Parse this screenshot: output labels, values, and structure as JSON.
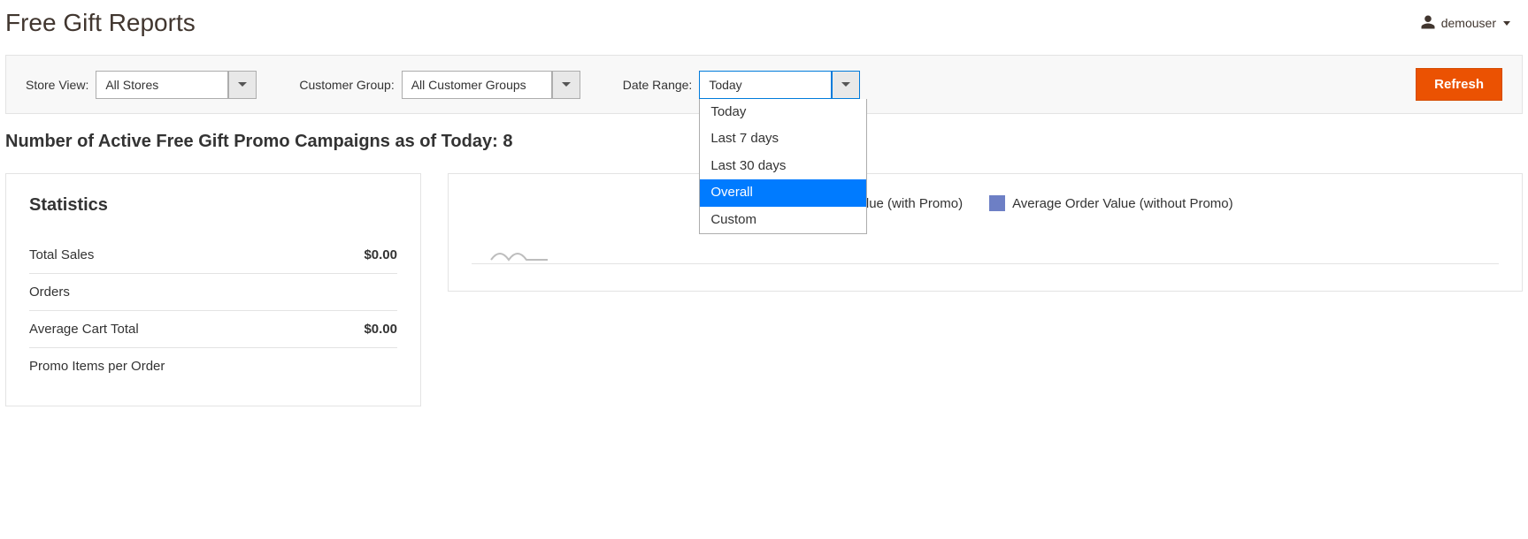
{
  "header": {
    "title": "Free Gift Reports",
    "user": "demouser"
  },
  "filters": {
    "store_view": {
      "label": "Store View:",
      "value": "All Stores"
    },
    "customer_group": {
      "label": "Customer Group:",
      "value": "All Customer Groups"
    },
    "date_range": {
      "label": "Date Range:",
      "value": "Today",
      "options": [
        "Today",
        "Last 7 days",
        "Last 30 days",
        "Overall",
        "Custom"
      ],
      "highlighted_index": 3
    },
    "refresh_label": "Refresh"
  },
  "summary": {
    "campaigns_heading": "Number of Active Free Gift Promo Campaigns as of Today: 8"
  },
  "stats": {
    "title": "Statistics",
    "rows": [
      {
        "label": "Total Sales",
        "value": "$0.00"
      },
      {
        "label": "Orders",
        "value": ""
      },
      {
        "label": "Average Cart Total",
        "value": "$0.00"
      },
      {
        "label": "Promo Items per Order",
        "value": ""
      }
    ]
  },
  "chart": {
    "legend": [
      {
        "label": "Average Order Value (with Promo)",
        "color": "#6fc7e0"
      },
      {
        "label": "Average Order Value (without Promo)",
        "color": "#6d7fc5"
      }
    ]
  },
  "chart_data": {
    "type": "line",
    "title": "",
    "xlabel": "",
    "ylabel": "",
    "x": [],
    "series": [
      {
        "name": "Average Order Value (with Promo)",
        "values": []
      },
      {
        "name": "Average Order Value (without Promo)",
        "values": []
      }
    ]
  }
}
